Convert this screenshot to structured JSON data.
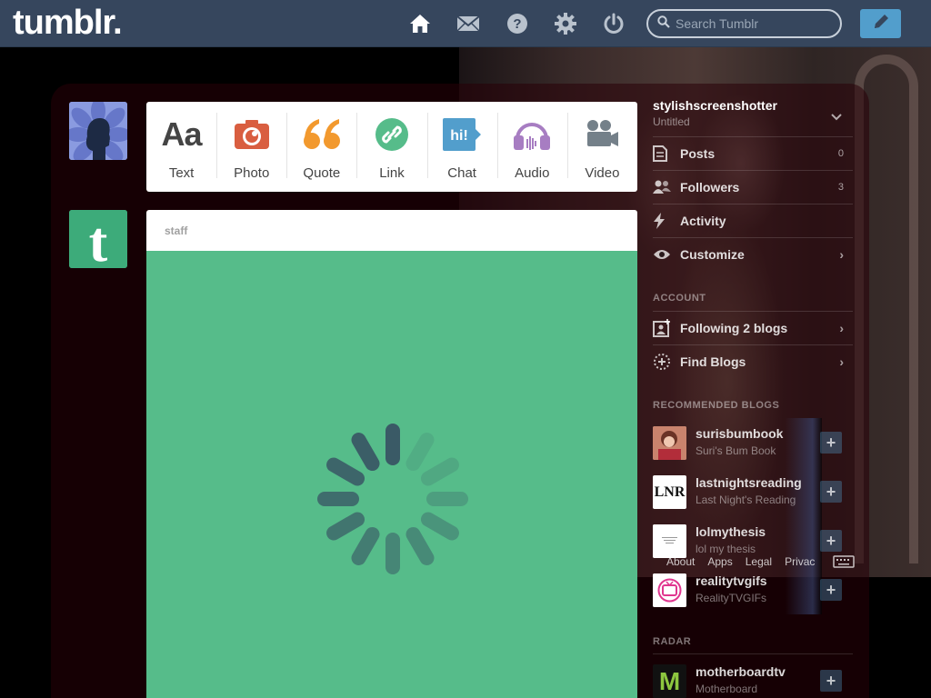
{
  "header": {
    "logo": "tumblr.",
    "search_placeholder": "Search Tumblr",
    "icons": [
      "home-icon",
      "inbox-icon",
      "help-icon",
      "settings-icon",
      "logout-icon"
    ],
    "compose_icon": "pencil-icon",
    "colors": {
      "bar": "#36465d",
      "compose": "#529ecc"
    }
  },
  "post_types": [
    {
      "label": "Text",
      "icon": "text-icon",
      "color": "#444444"
    },
    {
      "label": "Photo",
      "icon": "photo-icon",
      "color": "#d95e40"
    },
    {
      "label": "Quote",
      "icon": "quote-icon",
      "color": "#f2992e"
    },
    {
      "label": "Link",
      "icon": "link-icon",
      "color": "#56bc8a"
    },
    {
      "label": "Chat",
      "icon": "chat-icon",
      "color": "#529ecc"
    },
    {
      "label": "Audio",
      "icon": "audio-icon",
      "color": "#a77dc2"
    },
    {
      "label": "Video",
      "icon": "video-icon",
      "color": "#748089"
    }
  ],
  "staff_post": {
    "author": "staff",
    "media_color": "#56bc8a"
  },
  "sidebar": {
    "blog_name": "stylishscreenshotter",
    "blog_title": "Untitled",
    "menu": [
      {
        "label": "Posts",
        "count": "0",
        "icon": "posts-icon"
      },
      {
        "label": "Followers",
        "count": "3",
        "icon": "followers-icon"
      },
      {
        "label": "Activity",
        "icon": "activity-icon"
      },
      {
        "label": "Customize",
        "icon": "customize-icon"
      }
    ],
    "account_heading": "Account",
    "account_items": [
      {
        "label": "Following 2 blogs",
        "icon": "following-icon"
      },
      {
        "label": "Find Blogs",
        "icon": "find-blogs-icon"
      }
    ],
    "recommended_heading": "Recommended Blogs",
    "recommended": [
      {
        "name": "surisbumbook",
        "title": "Suri's Bum Book"
      },
      {
        "name": "lastnightsreading",
        "title": "Last Night's Reading",
        "thumb_text": "LNR"
      },
      {
        "name": "lolmythesis",
        "title": "lol my thesis"
      },
      {
        "name": "realitytvgifs",
        "title": "RealityTVGIFs"
      }
    ],
    "radar_heading": "Radar",
    "radar": [
      {
        "name": "motherboardtv",
        "title": "Motherboard",
        "thumb_text": "M"
      }
    ],
    "footer_links": [
      "About",
      "Apps",
      "Legal",
      "Privac"
    ]
  }
}
